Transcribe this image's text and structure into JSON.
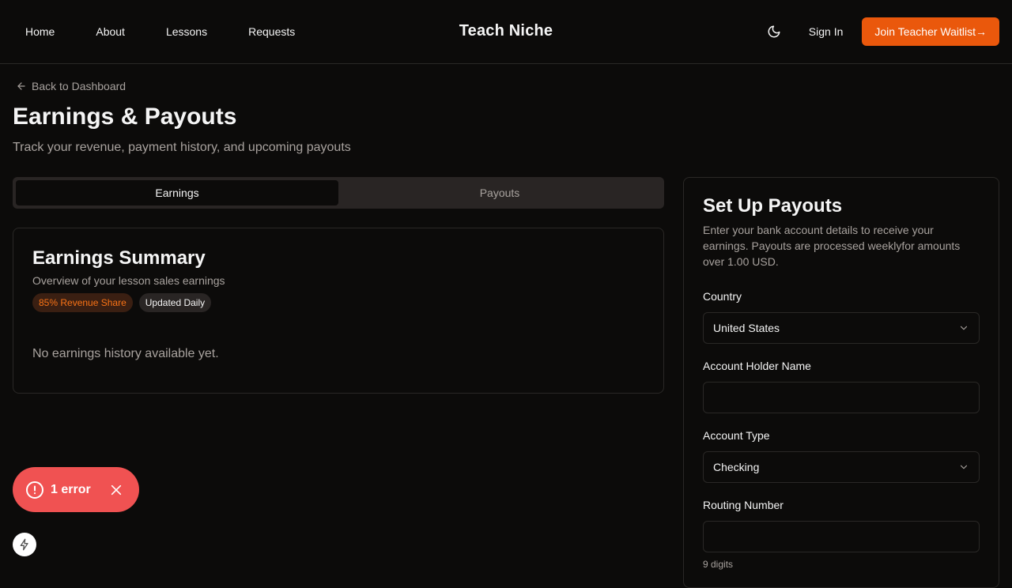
{
  "nav": {
    "items": [
      {
        "label": "Home"
      },
      {
        "label": "About"
      },
      {
        "label": "Lessons"
      },
      {
        "label": "Requests"
      }
    ],
    "brand": "Teach Niche",
    "theme_icon": "moon-icon",
    "signin_label": "Sign In",
    "join_label": "Join Teacher Waitlist→"
  },
  "page": {
    "back_label": "Back to Dashboard",
    "title": "Earnings & Payouts",
    "subtitle": "Track your revenue, payment history, and upcoming payouts"
  },
  "tabs": [
    {
      "label": "Earnings",
      "active": true
    },
    {
      "label": "Payouts",
      "active": false
    }
  ],
  "earnings": {
    "title": "Earnings Summary",
    "description": "Overview of your lesson sales earnings",
    "badges": [
      {
        "label": "85% Revenue Share"
      },
      {
        "label": "Updated Daily"
      }
    ],
    "empty_message": "No earnings history available yet."
  },
  "payouts": {
    "title": "Set Up Payouts",
    "description": "Enter your bank account details to receive your earnings. Payouts are processed weeklyfor amounts over 1.00 USD.",
    "country_label": "Country",
    "country_value": "United States",
    "holder_label": "Account Holder Name",
    "holder_value": "",
    "type_label": "Account Type",
    "type_value": "Checking",
    "routing_label": "Routing Number",
    "routing_value": "",
    "routing_hint": "9 digits"
  },
  "toast": {
    "label": "1 error"
  },
  "colors": {
    "accent": "#ea580c",
    "error": "#f05252",
    "background": "#0c0b0a"
  }
}
